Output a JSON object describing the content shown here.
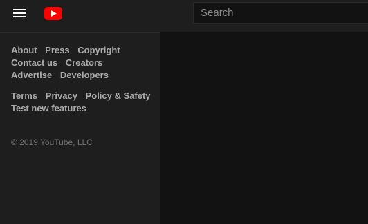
{
  "header": {
    "menu_icon": "hamburger-menu-icon",
    "logo_icon": "youtube-logo-icon",
    "logo_color": "#ff0000",
    "search": {
      "placeholder": "Search",
      "value": ""
    }
  },
  "guide": {
    "primary_links": [
      {
        "label": "About"
      },
      {
        "label": "Press"
      },
      {
        "label": "Copyright"
      },
      {
        "label": "Contact us"
      },
      {
        "label": "Creators"
      },
      {
        "label": "Advertise"
      },
      {
        "label": "Developers"
      }
    ],
    "secondary_links": [
      {
        "label": "Terms"
      },
      {
        "label": "Privacy"
      },
      {
        "label": "Policy & Safety"
      },
      {
        "label": "Test new features"
      }
    ],
    "copyright": "© 2019 YouTube, LLC"
  }
}
